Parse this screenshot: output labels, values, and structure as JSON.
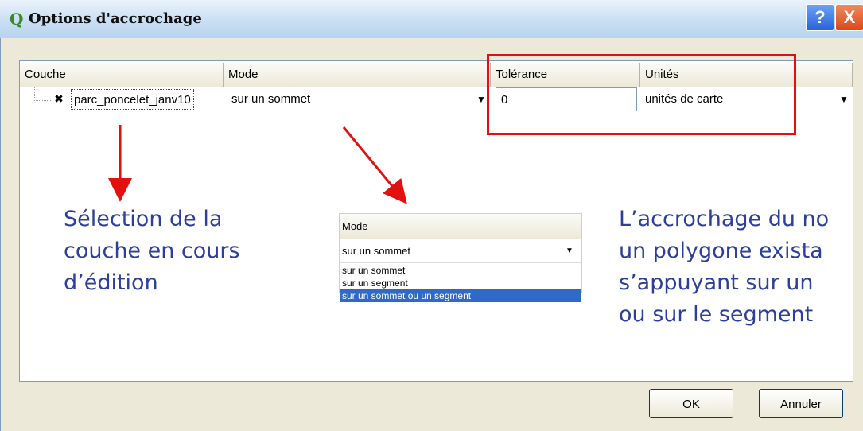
{
  "window": {
    "title": "Options d'accrochage",
    "app_icon": "Q",
    "help": "?",
    "close": "X"
  },
  "table": {
    "headers": [
      "Couche",
      "Mode",
      "Tolérance",
      "Unités"
    ],
    "row": {
      "checkbox_mark": "✖",
      "layer": "parc_poncelet_janv10",
      "mode": "sur un sommet",
      "tolerance": "0",
      "units": "unités de carte"
    }
  },
  "annotations": {
    "left_line1": "Sélection de la",
    "left_line2": "couche en cours",
    "left_line3": "d’édition",
    "right_line1": "L’accrochage du no",
    "right_line2": "un polygone exista",
    "right_line3": "s’appuyant sur un",
    "right_line4": "ou sur le segment"
  },
  "mode_dropdown": {
    "header": "Mode",
    "selected": "sur un sommet",
    "options": [
      "sur un sommet",
      "sur un segment",
      "sur un sommet ou un segment"
    ],
    "highlighted_index": 2
  },
  "buttons": {
    "ok": "OK",
    "cancel": "Annuler"
  },
  "colors": {
    "annotation": "#2d3f9a",
    "highlight_box": "#e31010",
    "selection": "#3169c6"
  }
}
